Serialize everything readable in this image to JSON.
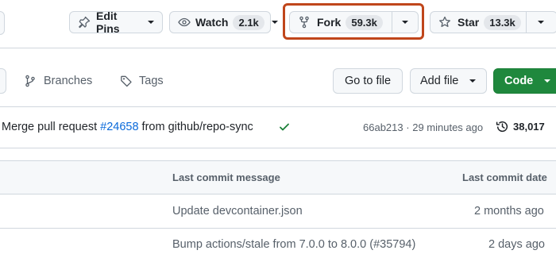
{
  "header": {
    "edit_pins": {
      "label": "Edit Pins"
    },
    "watch": {
      "label": "Watch",
      "count": "2.1k"
    },
    "fork": {
      "label": "Fork",
      "count": "59.3k"
    },
    "star": {
      "label": "Star",
      "count": "13.3k"
    }
  },
  "toolbar": {
    "branches_label": "Branches",
    "tags_label": "Tags",
    "go_to_file": "Go to file",
    "add_file": "Add file",
    "code": "Code"
  },
  "commit": {
    "message_prefix": "Merge pull request",
    "pr_number": "#24658",
    "message_suffix": "from github/repo-sync",
    "sha": "66ab213",
    "separator": "·",
    "time": "29 minutes ago",
    "commit_count": "38,017"
  },
  "file_table": {
    "headers": {
      "message": "Last commit message",
      "date": "Last commit date"
    },
    "rows": [
      {
        "message": "Update devcontainer.json",
        "date": "2 months ago"
      },
      {
        "message": "Bump actions/stale from 7.0.0 to 8.0.0 (#35794)",
        "date": "2 days ago"
      }
    ]
  },
  "colors": {
    "accent_link": "#0969da",
    "code_button": "#1f883d",
    "fork_highlight": "#c0461b",
    "success_check": "#1a7f37"
  }
}
